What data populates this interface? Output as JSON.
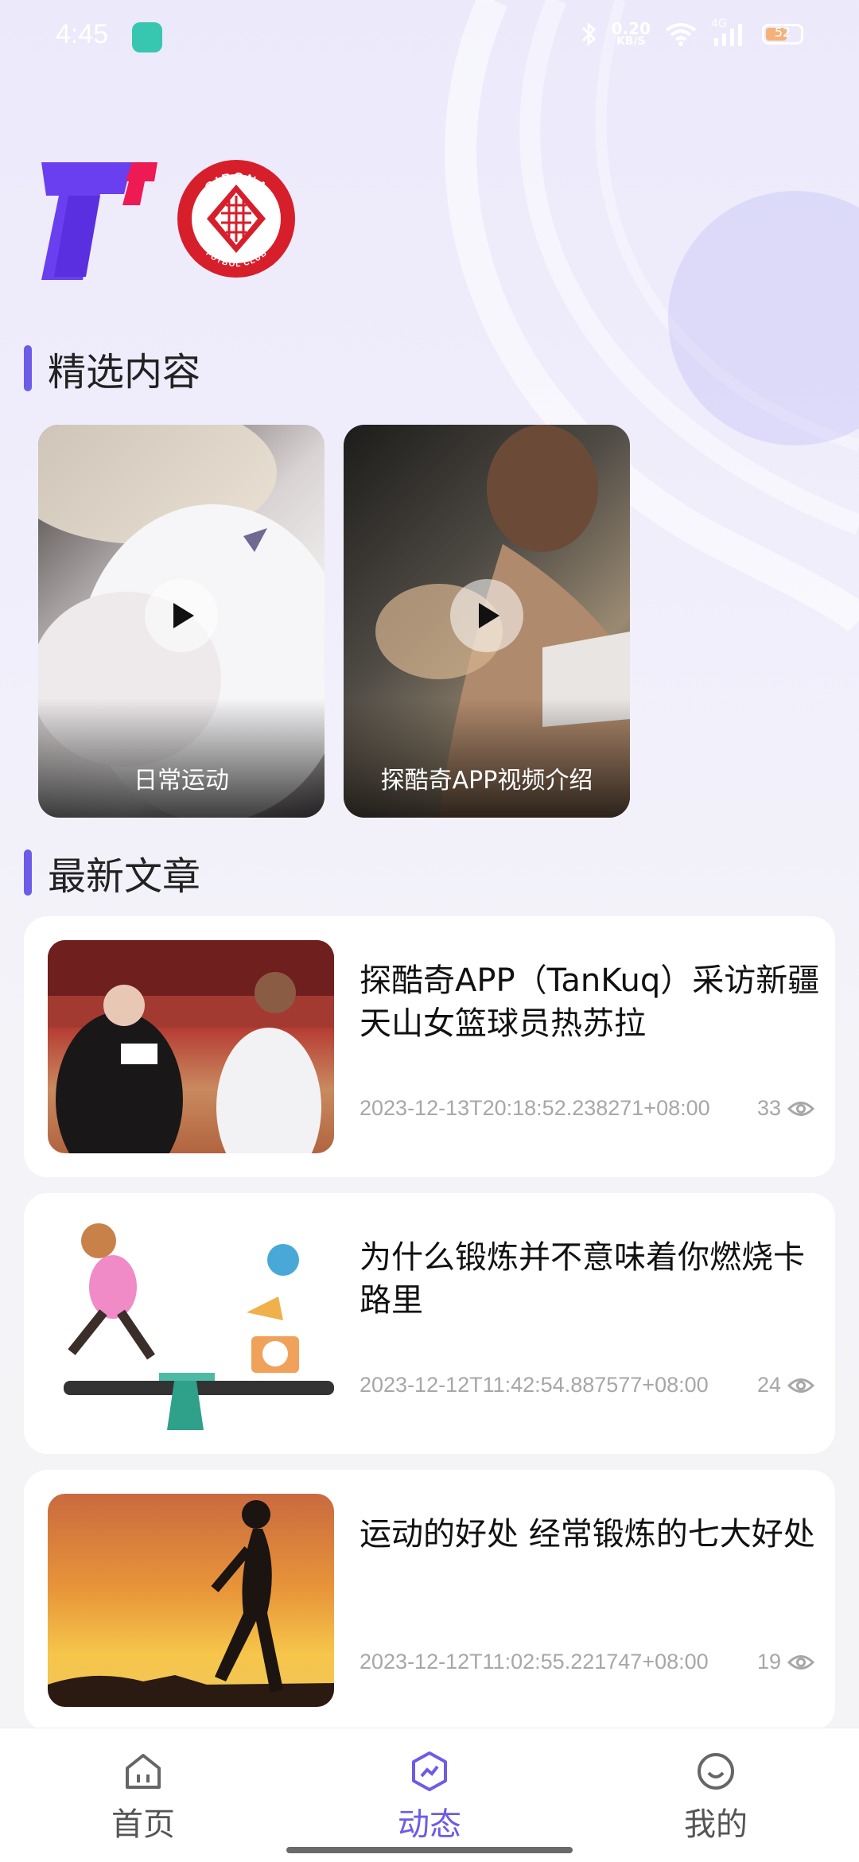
{
  "status_bar": {
    "time": "4:45",
    "net_speed_value": "0.20",
    "net_speed_unit": "KB/S",
    "network": "4G",
    "battery": "52"
  },
  "logos": {
    "girona": {
      "top": "GIRONA",
      "bottom": "FUTBOL CLUB"
    }
  },
  "featured": {
    "title": "精选内容",
    "videos": [
      {
        "caption": "日常运动"
      },
      {
        "caption": "探酷奇APP视频介绍"
      }
    ]
  },
  "articles": {
    "title": "最新文章",
    "items": [
      {
        "title": "探酷奇APP（TanKuq）采访新疆天山女篮球员热苏拉",
        "time": "2023-12-13T20:18:52.238271+08:00",
        "views": "33"
      },
      {
        "title": "为什么锻炼并不意味着你燃烧卡路里",
        "time": "2023-12-12T11:42:54.887577+08:00",
        "views": "24"
      },
      {
        "title": "运动的好处 经常锻炼的七大好处",
        "time": "2023-12-12T11:02:55.221747+08:00",
        "views": "19"
      }
    ]
  },
  "nav": {
    "items": [
      {
        "label": "首页"
      },
      {
        "label": "动态"
      },
      {
        "label": "我的"
      }
    ],
    "active_color": "#6c5ce7"
  },
  "colors": {
    "accent": "#6c5ce7",
    "logo_t_purple": "#6a3ff0",
    "logo_t_pink": "#ee1a53",
    "girona_red": "#d61f2b"
  }
}
